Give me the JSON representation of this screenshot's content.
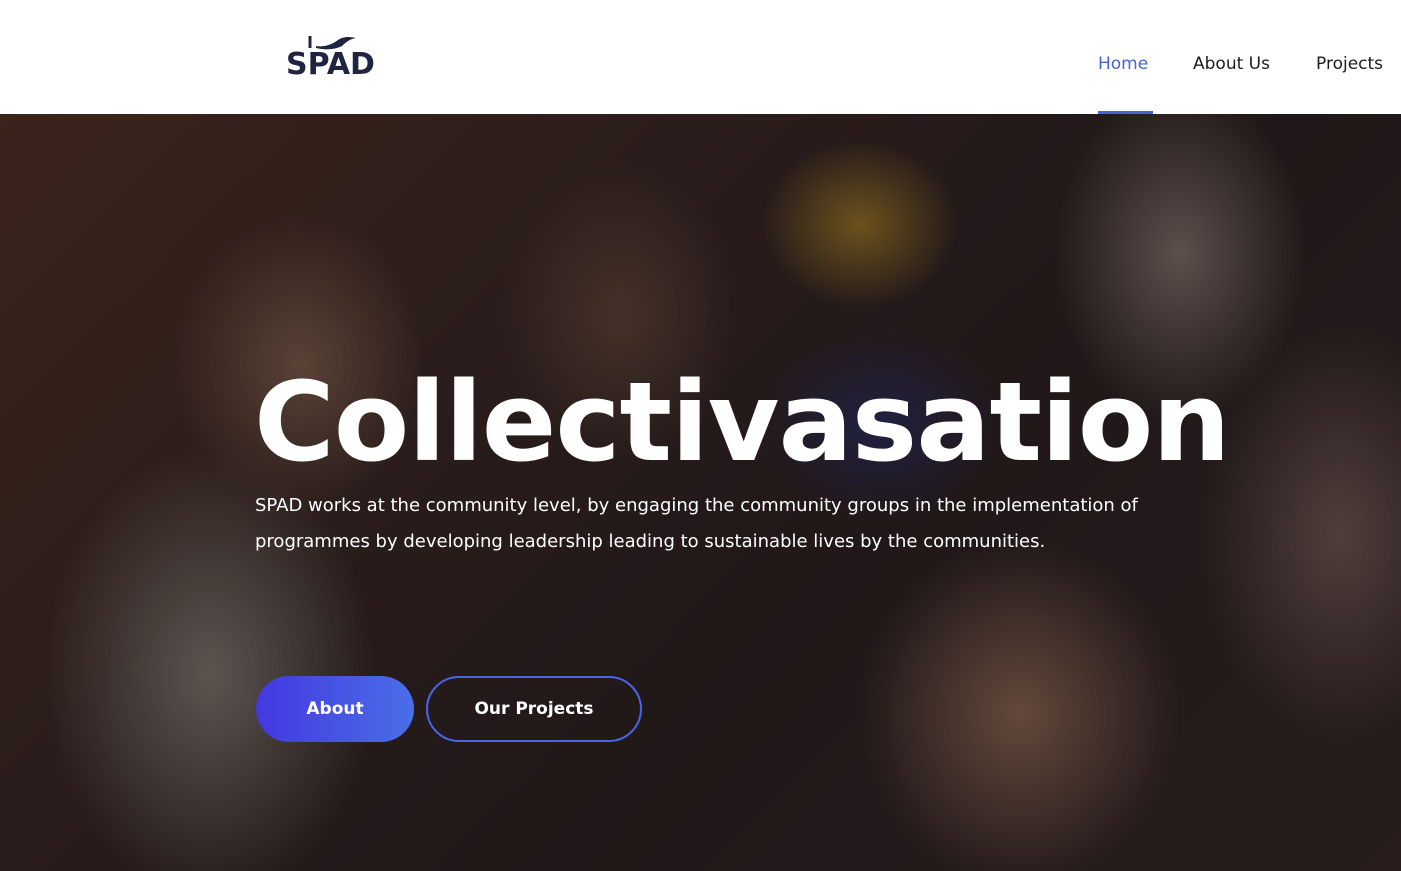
{
  "brand": {
    "logo_text": "SPAD",
    "logo_icon": "hand-icon"
  },
  "nav": {
    "items": [
      {
        "label": "Home",
        "active": true
      },
      {
        "label": "About Us",
        "active": false
      },
      {
        "label": "Projects",
        "active": false
      }
    ]
  },
  "hero": {
    "title": "Collectivasation",
    "description": "SPAD works at the community level, by engaging the community groups in the implementation of programmes by developing leadership leading to sustainable lives by the communities.",
    "buttons": {
      "about_label": "About",
      "projects_label": "Our Projects"
    },
    "background_image": "smiling-children-photo"
  },
  "colors": {
    "accent": "#4564d6",
    "brand_dark": "#1f2440",
    "button_gradient_start": "#4338e0",
    "button_gradient_end": "#4a6ee8"
  }
}
